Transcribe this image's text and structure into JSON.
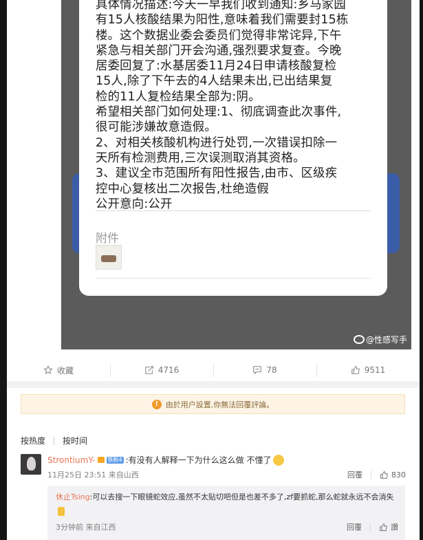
{
  "post_image": {
    "body_text": "具体情况描述:今天一早我们收到通知:乡马家园\n有15人核酸结果为阳性,意味着我们需要封15栋\n楼。这个数据业委会委员们觉得非常诧异,下午\n紧急与相关部门开会沟通,强烈要求复查。今晚\n居委回复了:水基居委11月24日申请核酸复检\n15人,除了下午去的4人结果未出,已出结果复\n检的11人复检结果全部为:阴。\n希望相关部门如何处理:1、彻底调查此次事件,\n很可能涉嫌故意造假。\n2、对相关核酸机构进行处罚,一次错误扣除一\n天所有检测费用,三次误测取消其资格。\n3、建议全市范围所有阳性报告,由市、区级疾\n控中心复核出二次报告,杜绝造假\n公开意向:公开",
    "attachment_label": "附件",
    "watermark": "@性感写手"
  },
  "actions": {
    "favorite_label": "收藏",
    "repost_count": "4716",
    "comment_count": "78",
    "like_count": "9511"
  },
  "notice": {
    "text": "由於用户設置,你無法回覆評論。"
  },
  "sort": {
    "hot": "按热度",
    "time": "按时间"
  },
  "comments": [
    {
      "username": "StrontiumY-",
      "badge": "铁粉4",
      "text": ":有没有人解释一下为什么这么做 不懂了",
      "time": "11月25日 23:51",
      "location": "来自山西",
      "reply_label": "回覆",
      "likes": "830"
    }
  ],
  "reply": {
    "username": "休止Tsing",
    "text": ":可以去搜一下眼镜蛇效应,虽然不太贴切吧但是也差不多了,zf要抓蛇,那么蛇就永远不会消失",
    "time": "3分钟前",
    "location": "来自江西",
    "reply_label": "回覆",
    "like_label": "讚"
  },
  "colors": {
    "username": "#eb7350",
    "notice_bg": "#fdf4e6",
    "warn": "#f09a2c"
  }
}
